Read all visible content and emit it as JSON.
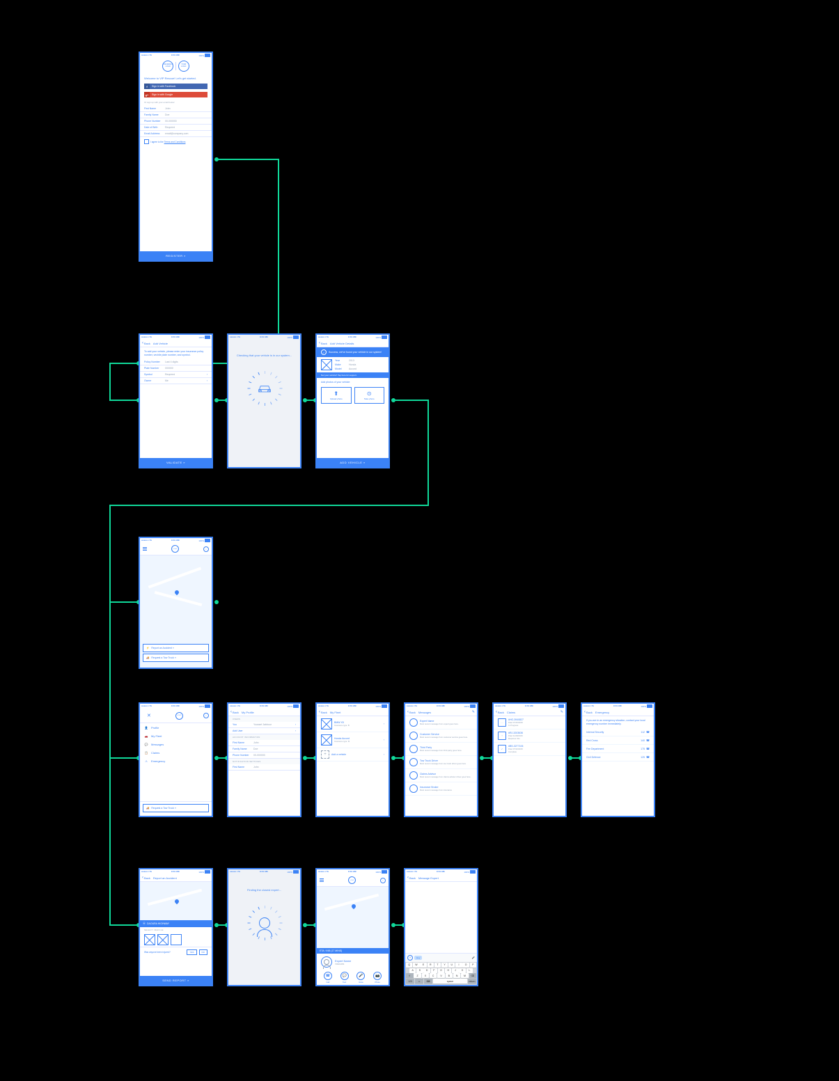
{
  "status": {
    "carrier": "●●●●● LTE",
    "time": "9:41 AM",
    "battery": "100%"
  },
  "register": {
    "logo1": "INSURANCE\nLOGO",
    "logo2": "YOUR\nLOGO",
    "welcome": "Welcome to VIP Rescue! Let's get started.",
    "fb": "Sign in with Facebook",
    "gp": "Sign in with Google",
    "or": "Or sign up with your email below:",
    "fields": [
      {
        "lbl": "First Name",
        "val": "John"
      },
      {
        "lbl": "Family Name",
        "val": "Doe"
      },
      {
        "lbl": "Phone Number",
        "val": "00-000000"
      },
      {
        "lbl": "Date of Birth",
        "val": "Required"
      },
      {
        "lbl": "Email Address",
        "val": "email@company.com"
      }
    ],
    "agree_pre": "I agree to the ",
    "agree_link": "Terms and Conditions",
    "btn": "REGISTER »"
  },
  "add_vehicle": {
    "back": "Back",
    "title": "Add Vehicle",
    "intro": "To add your vehicle, please enter your insurance policy number, vechile plate number, and symbol.",
    "fields": [
      {
        "lbl": "Policy Number",
        "val": "Last 4 digits"
      },
      {
        "lbl": "Plate Number",
        "val": "000000"
      },
      {
        "lbl": "Symbol",
        "val": "Required",
        "chev": true
      },
      {
        "lbl": "Owner",
        "val": "Me",
        "chev": true
      }
    ],
    "btn": "VALIDATE »"
  },
  "checking": {
    "txt": "Checking that your vehicle is in our system..."
  },
  "add_details": {
    "back": "Back",
    "title": "Add Vehicle Details",
    "success": "Success, we've found your vehicle in our system!",
    "fields": [
      {
        "lbl": "Year",
        "val": "2013"
      },
      {
        "lbl": "Make",
        "val": "Honda"
      },
      {
        "lbl": "Model",
        "val": "Accord"
      }
    ],
    "warning": "Not your vehicle? Tap here for support.",
    "photos_hdr": "Add photos of your vehicle:",
    "upload": "Upload photo",
    "take": "Take photo",
    "btn": "ADD VEHICLE »"
  },
  "home": {
    "logo": "LOGO",
    "accident": "Report an Accident »",
    "tow": "Request a Tow Truck »"
  },
  "menu": {
    "logo": "LOGO",
    "items": [
      "Profile",
      "My Fleet",
      "Messages",
      "Claims",
      "Emergency"
    ],
    "tow": "Request a Tow Truck »"
  },
  "profile": {
    "back": "Back",
    "title": "My Profile",
    "sec_users": "USERS",
    "user_name": "Youssef Jabbour",
    "add_user": "Add User",
    "sec_account": "ACCOUNT INFORMATION",
    "fields": [
      {
        "lbl": "First Name",
        "val": "John"
      },
      {
        "lbl": "Family Name",
        "val": "Doe"
      },
      {
        "lbl": "Phone Number",
        "val": "00-000000"
      }
    ],
    "sec_notif": "NOTIFICATION SETTINGS",
    "notif_field": {
      "lbl": "First Name",
      "val": "John"
    }
  },
  "fleet": {
    "back": "Back",
    "title": "My Fleet",
    "items": [
      {
        "t1": "BMW X5",
        "t2": "Insurance type: B"
      },
      {
        "t1": "Honda Accord",
        "t2": "Insurance type: M"
      }
    ],
    "add": "Add a vehicle"
  },
  "messages": {
    "back": "Back",
    "title": "Messages",
    "items": [
      {
        "t1": "Expert Name",
        "t2": "Most recent message from expert goes here."
      },
      {
        "t1": "Customer Service",
        "t2": "Most recent message from customer service goes here."
      },
      {
        "t1": "Third Party",
        "t2": "Most recent message from third party goes here."
      },
      {
        "t1": "Tow Truck Driver",
        "t2": "Most recent message from tow truck driver goes here."
      },
      {
        "t1": "Claims Advisor",
        "t2": "Most recent message from claims advisor driver goes here."
      },
      {
        "t1": "Insurance Broker",
        "t2": "Most recent message from insurance"
      }
    ]
  },
  "claims": {
    "back": "Back",
    "title": "Claims",
    "items": [
      {
        "ico": "····",
        "id": "#HO-3940827",
        "date": "Filed 07/15/2015",
        "status": "In Progress"
      },
      {
        "ico": "!",
        "id": "#RJ-3203636",
        "date": "Filed 11/28/2015",
        "status": "Requires Info"
      },
      {
        "ico": "✓",
        "id": "#BS-3277106",
        "date": "Filed 07/10/2015",
        "status": "Complete"
      }
    ]
  },
  "emergency": {
    "back": "Back",
    "title": "Emergency",
    "intro": "If you are in an emergency situation, contact your local emergency number immediately.",
    "items": [
      {
        "name": "Internal Security",
        "num": "112"
      },
      {
        "name": "Red Cross",
        "num": "140"
      },
      {
        "name": "Fire Department",
        "num": "175"
      },
      {
        "name": "Civil Defence",
        "num": "125"
      }
    ]
  },
  "report": {
    "back": "Back",
    "title": "Report an Accident",
    "loc": "DAOURA HIGHWAY",
    "sel": "SELECT VEHICLE",
    "injured": "Was anyone been injured?",
    "yes": "YES",
    "no": "NO",
    "btn": "SEND REPORT »"
  },
  "finding": {
    "txt": "Finding the closest expert..."
  },
  "expert": {
    "logo": "LOGO",
    "eta": "ETA: 9:58 (17 MINS)",
    "name": "Expert Name",
    "phone": "70822456",
    "actions": [
      "Call",
      "Text",
      "Voice",
      "Photo"
    ]
  },
  "chat": {
    "back": "Back",
    "title": "Message Expert",
    "tag": "Hey",
    "kb_rows": [
      [
        "Q",
        "W",
        "E",
        "R",
        "T",
        "Y",
        "U",
        "I",
        "O",
        "P"
      ],
      [
        "A",
        "S",
        "D",
        "F",
        "G",
        "H",
        "J",
        "K",
        "L"
      ],
      [
        "⇧",
        "Z",
        "X",
        "C",
        "V",
        "B",
        "N",
        "M",
        "⌫"
      ]
    ],
    "kb_bottom": [
      "123",
      "☺",
      "⌨",
      "space",
      "return"
    ]
  }
}
